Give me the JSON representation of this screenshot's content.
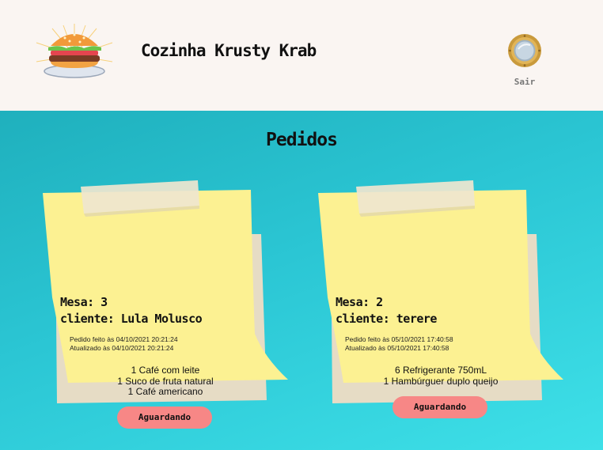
{
  "header": {
    "title": "Cozinha Krusty Krab",
    "logo_icon": "burger-icon",
    "exit": {
      "label": "Sair",
      "icon": "porthole-exit-icon"
    }
  },
  "main": {
    "title": "Pedidos",
    "orders": [
      {
        "mesa": "Mesa: 3",
        "cliente": "cliente: Lula Molusco",
        "created": "Pedido feito às 04/10/2021 20:21:24",
        "updated": "Atualizado às 04/10/2021 20:21:24",
        "items": [
          "1 Café com leite",
          "1 Suco de fruta natural",
          "1 Café americano"
        ],
        "status": "Aguardando"
      },
      {
        "mesa": "Mesa: 2",
        "cliente": "cliente: terere",
        "created": "Pedido feito às 05/10/2021 17:40:58",
        "updated": "Atualizado às 05/10/2021 17:40:58",
        "items": [
          "6 Refrigerante 750mL",
          "1 Hambúrguer duplo queijo"
        ],
        "status": "Aguardando"
      }
    ]
  },
  "colors": {
    "header_bg": "#faf5f2",
    "note_yellow": "#fcf192",
    "note_back": "#e6dcc5",
    "tape": "#efe6cf",
    "button": "#f78786",
    "teal": "#2bc6d4"
  }
}
